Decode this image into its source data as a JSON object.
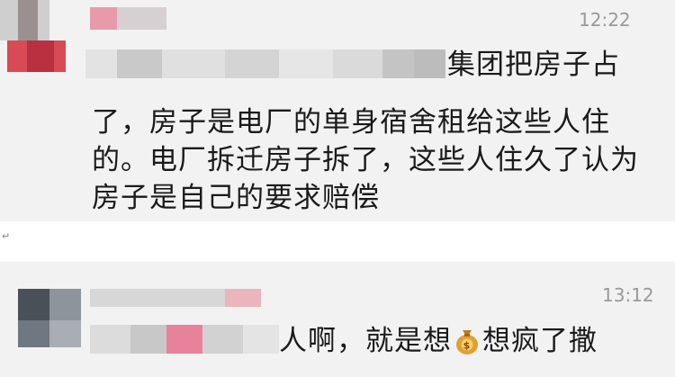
{
  "messages": [
    {
      "time": "12:22",
      "line1_tail": "集团把房子占",
      "line2": "了，房子是电厂的单身宿舍租给这些人住",
      "line3": "的。电厂拆迁房子拆了，这些人住久了认为",
      "line4": "房子是自己的要求赔偿"
    },
    {
      "time": "13:12",
      "text_before_icon": "人啊，就是想",
      "icon": "money-bag-icon",
      "text_after_icon": "想疯了撒"
    }
  ],
  "paragraph_mark": "↵",
  "colors": {
    "card_bg": "#f2f2f2",
    "time": "#999999",
    "text": "#1a1a1a",
    "pixel_pink": "#e7829a",
    "pixel_red": "#c9403f"
  }
}
